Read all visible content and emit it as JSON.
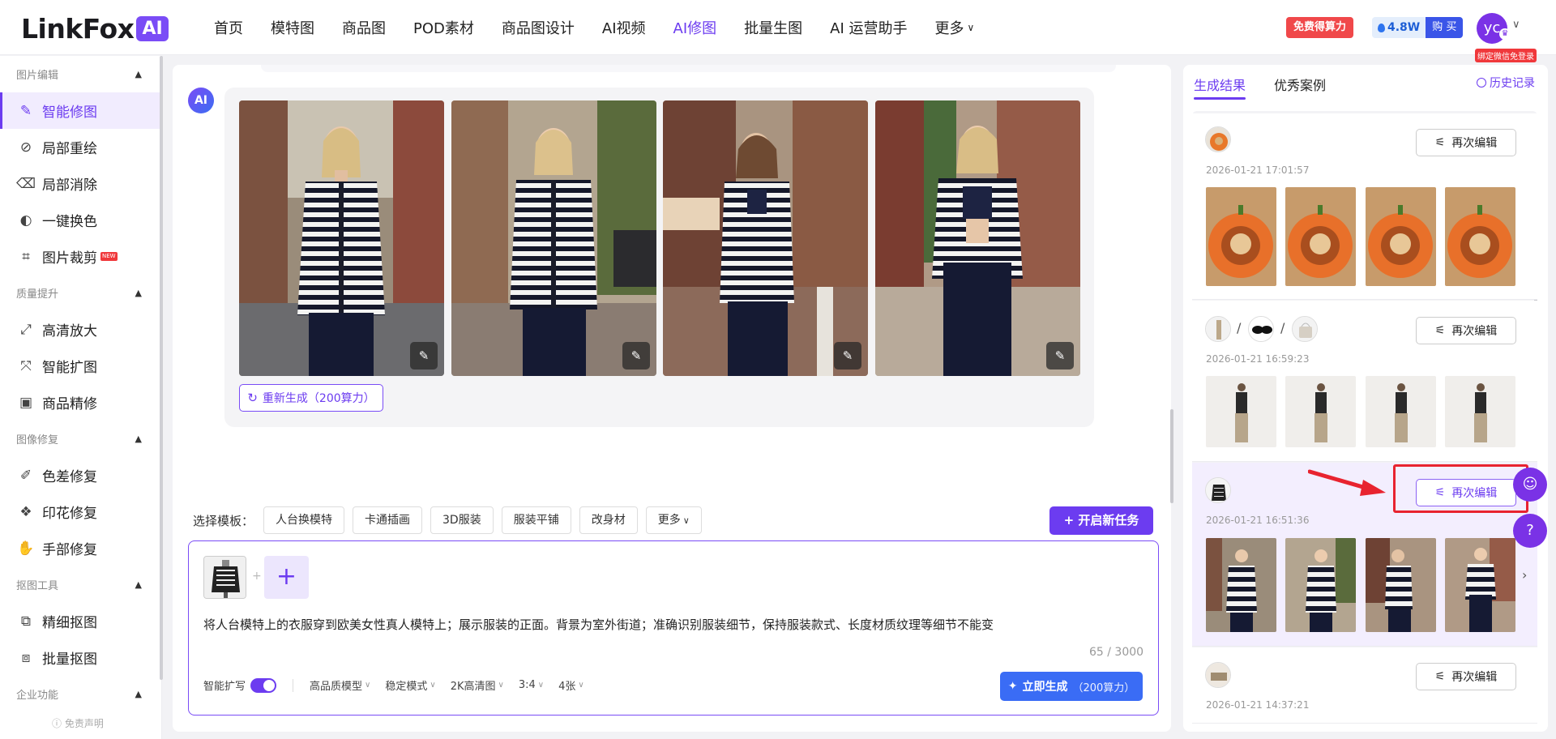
{
  "brand": {
    "name": "LinkFox",
    "badge": "AI"
  },
  "nav": {
    "items": [
      "首页",
      "模特图",
      "商品图",
      "POD素材",
      "商品图设计",
      "AI视频",
      "AI修图",
      "批量生图",
      "AI 运营助手"
    ],
    "active": "AI修图",
    "more": "更多"
  },
  "header": {
    "free_label": "免费得算力",
    "power_value": "4.8W",
    "buy_label": "购 买",
    "avatar_text": "yc",
    "avatar_tag": "绑定微信免登录"
  },
  "sidebar": {
    "groups": [
      {
        "title": "图片编辑",
        "items": [
          "智能修图",
          "局部重绘",
          "局部消除",
          "一键换色",
          "图片裁剪"
        ]
      },
      {
        "title": "质量提升",
        "items": [
          "高清放大",
          "智能扩图",
          "商品精修"
        ]
      },
      {
        "title": "图像修复",
        "items": [
          "色差修复",
          "印花修复",
          "手部修复"
        ]
      },
      {
        "title": "抠图工具",
        "items": [
          "精细抠图",
          "批量抠图"
        ]
      },
      {
        "title": "企业功能",
        "items": []
      }
    ],
    "active_item": "智能修图",
    "new_badge": "NEW",
    "footer": "免责声明"
  },
  "result": {
    "ai_label": "AI",
    "regenerate_label": "重新生成（200算力）"
  },
  "templates": {
    "label": "选择模板：",
    "chips": [
      "人台换模特",
      "卡通插画",
      "3D服装",
      "服装平铺",
      "改身材"
    ],
    "more": "更多",
    "new_task": "+ 开启新任务"
  },
  "composer": {
    "prompt": "将人台模特上的衣服穿到欧美女性真人模特上；展示服装的正面。背景为室外街道；准确识别服装细节，保持服装款式、长度材质纹理等细节不能变",
    "counter": "65 / 3000",
    "smart_expand_label": "智能扩写",
    "smart_expand_on": true,
    "options": [
      "高品质模型",
      "稳定模式",
      "2K高清图",
      "3:4",
      "4张"
    ],
    "generate_label": "立即生成",
    "generate_cost": "（200算力）"
  },
  "right_panel": {
    "tabs": [
      "生成结果",
      "优秀案例"
    ],
    "active_tab": "生成结果",
    "history_label": "历史记录",
    "reedit_label": "再次编辑",
    "entries": [
      {
        "time": "2026-01-21 17:01:57",
        "kind": "pet-bed"
      },
      {
        "time": "2026-01-21 16:59:23",
        "kind": "outfit"
      },
      {
        "time": "2026-01-21 16:51:36",
        "kind": "striped-cardigan",
        "highlighted": true
      },
      {
        "time": "2026-01-21 14:37:21",
        "kind": "misc"
      }
    ]
  },
  "colors": {
    "accent": "#6c3cf0",
    "primary_blue": "#3a6cf5",
    "alert_red": "#e8232f"
  }
}
